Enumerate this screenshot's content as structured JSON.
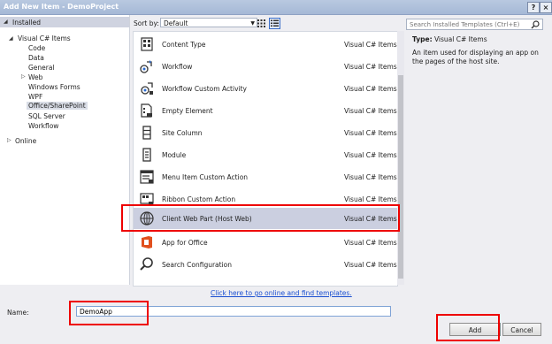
{
  "window": {
    "title": "Add New Item - DemoProject",
    "help": "?",
    "close": "×"
  },
  "tree": {
    "installed": "Installed",
    "visual_cs": "Visual C# Items",
    "items": [
      "Code",
      "Data",
      "General",
      "Web",
      "Windows Forms",
      "WPF",
      "Office/SharePoint",
      "SQL Server",
      "Workflow"
    ],
    "online": "Online"
  },
  "toolbar": {
    "sort_label": "Sort by:",
    "sort_value": "Default"
  },
  "search": {
    "placeholder": "Search Installed Templates (Ctrl+E)"
  },
  "templates": [
    {
      "name": "Content Type",
      "category": "Visual C# Items",
      "icon": "content-type-icon"
    },
    {
      "name": "Workflow",
      "category": "Visual C# Items",
      "icon": "workflow-icon"
    },
    {
      "name": "Workflow Custom Activity",
      "category": "Visual C# Items",
      "icon": "workflow-activity-icon"
    },
    {
      "name": "Empty Element",
      "category": "Visual C# Items",
      "icon": "empty-element-icon"
    },
    {
      "name": "Site Column",
      "category": "Visual C# Items",
      "icon": "site-column-icon"
    },
    {
      "name": "Module",
      "category": "Visual C# Items",
      "icon": "module-icon"
    },
    {
      "name": "Menu Item Custom Action",
      "category": "Visual C# Items",
      "icon": "menu-action-icon"
    },
    {
      "name": "Ribbon Custom Action",
      "category": "Visual C# Items",
      "icon": "ribbon-action-icon"
    },
    {
      "name": "Client Web Part (Host Web)",
      "category": "Visual C# Items",
      "icon": "globe-icon"
    },
    {
      "name": "App for Office",
      "category": "Visual C# Items",
      "icon": "office-icon"
    },
    {
      "name": "Search Configuration",
      "category": "Visual C# Items",
      "icon": "search-icon"
    }
  ],
  "description": {
    "type_label": "Type:",
    "type_value": "Visual C# Items",
    "text": "An item used for displaying an app on the pages of the host site."
  },
  "online_link": "Click here to go online and find templates.",
  "name_field": {
    "label": "Name:",
    "value": "DemoApp"
  },
  "buttons": {
    "add": "Add",
    "cancel": "Cancel"
  },
  "colors": {
    "highlight_box": "#e00000",
    "link": "#1a4fd1",
    "selected_row": "#cbcfe0"
  }
}
